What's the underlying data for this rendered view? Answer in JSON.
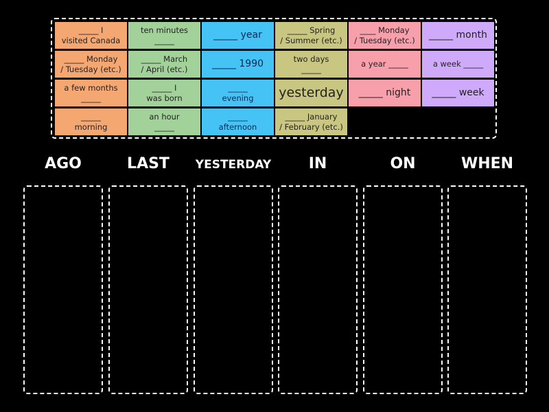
{
  "tiles": [
    {
      "text": "_____ I\nvisited Canada",
      "color": "orange"
    },
    {
      "text": "ten minutes\n_____",
      "color": "green"
    },
    {
      "text": "_____ year",
      "color": "blue"
    },
    {
      "text": "_____ Spring\n/ Summer (etc.)",
      "color": "olive"
    },
    {
      "text": "____ Monday\n/ Tuesday (etc.)",
      "color": "pink"
    },
    {
      "text": "_____ month",
      "color": "purple"
    },
    {
      "text": "_____ Monday\n/ Tuesday (etc.)",
      "color": "orange"
    },
    {
      "text": "_____ March\n/ April (etc.)",
      "color": "green"
    },
    {
      "text": "_____ 1990",
      "color": "blue"
    },
    {
      "text": "two days\n_____",
      "color": "olive"
    },
    {
      "text": "a year _____",
      "color": "pink"
    },
    {
      "text": "a week _____",
      "color": "purple"
    },
    {
      "text": "a few months\n_____",
      "color": "orange"
    },
    {
      "text": "_____ I\nwas born",
      "color": "green"
    },
    {
      "text": "_____\nevening",
      "color": "blue"
    },
    {
      "text": "yesterday",
      "color": "olive"
    },
    {
      "text": "_____ night",
      "color": "pink"
    },
    {
      "text": "_____ week",
      "color": "purple"
    },
    {
      "text": "_____\nmorning",
      "color": "orange"
    },
    {
      "text": "an hour\n_____",
      "color": "green"
    },
    {
      "text": "_____\nafternoon",
      "color": "blue"
    },
    {
      "text": "_____ January\n/ February (etc.)",
      "color": "olive"
    }
  ],
  "categories": [
    {
      "label": "AGO"
    },
    {
      "label": "LAST"
    },
    {
      "label": "YESTERDAY"
    },
    {
      "label": "IN"
    },
    {
      "label": "ON"
    },
    {
      "label": "WHEN"
    }
  ],
  "colors": {
    "orange": "#f5a772",
    "green": "#a3d19a",
    "blue": "#45c3f5",
    "olive": "#c9c681",
    "pink": "#f7a0ab",
    "purple": "#cfaafb",
    "background": "#000000"
  }
}
